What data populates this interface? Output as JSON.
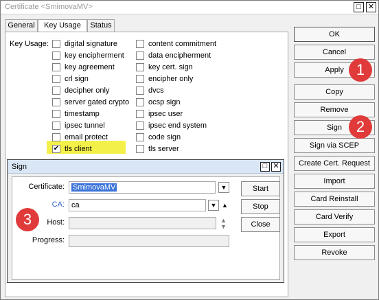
{
  "window": {
    "title": "Certificate <SmimovaMV>",
    "maximize_glyph": "□",
    "close_glyph": "✕"
  },
  "tabs": [
    {
      "label": "General",
      "active": false
    },
    {
      "label": "Key Usage",
      "active": true
    },
    {
      "label": "Status",
      "active": false
    }
  ],
  "key_usage": {
    "label": "Key Usage:",
    "col1": [
      {
        "label": "digital signature",
        "checked": false
      },
      {
        "label": "key encipherment",
        "checked": false
      },
      {
        "label": "key agreement",
        "checked": false
      },
      {
        "label": "crl sign",
        "checked": false
      },
      {
        "label": "decipher only",
        "checked": false
      },
      {
        "label": "server gated crypto",
        "checked": false
      },
      {
        "label": "timestamp",
        "checked": false
      },
      {
        "label": "ipsec tunnel",
        "checked": false
      },
      {
        "label": "email protect",
        "checked": false
      },
      {
        "label": "tls client",
        "checked": true
      }
    ],
    "col2": [
      {
        "label": "content commitment",
        "checked": false
      },
      {
        "label": "data encipherment",
        "checked": false
      },
      {
        "label": "key cert. sign",
        "checked": false
      },
      {
        "label": "encipher only",
        "checked": false
      },
      {
        "label": "dvcs",
        "checked": false
      },
      {
        "label": "ocsp sign",
        "checked": false
      },
      {
        "label": "ipsec user",
        "checked": false
      },
      {
        "label": "ipsec end system",
        "checked": false
      },
      {
        "label": "code sign",
        "checked": false
      },
      {
        "label": "tls server",
        "checked": false
      }
    ],
    "highlight_color": "#f4f04a"
  },
  "buttons": {
    "ok": "OK",
    "cancel": "Cancel",
    "apply": "Apply",
    "copy": "Copy",
    "remove": "Remove",
    "sign": "Sign",
    "sign_via_scep": "Sign via SCEP",
    "create_cert_request": "Create Cert. Request",
    "import": "Import",
    "card_reinstall": "Card Reinstall",
    "card_verify": "Card Verify",
    "export": "Export",
    "revoke": "Revoke"
  },
  "sign_dialog": {
    "title": "Sign",
    "certificate_label": "Certificate:",
    "certificate_value": "SmimovaMV",
    "ca_label": "CA:",
    "ca_value": "ca",
    "host_label": "Host:",
    "host_value": "",
    "progress_label": "Progress:",
    "progress_value": "",
    "start": "Start",
    "stop": "Stop",
    "close": "Close"
  },
  "annotations": {
    "badge1": "1",
    "badge2": "2",
    "badge3": "3",
    "color": "#e03a3a"
  }
}
